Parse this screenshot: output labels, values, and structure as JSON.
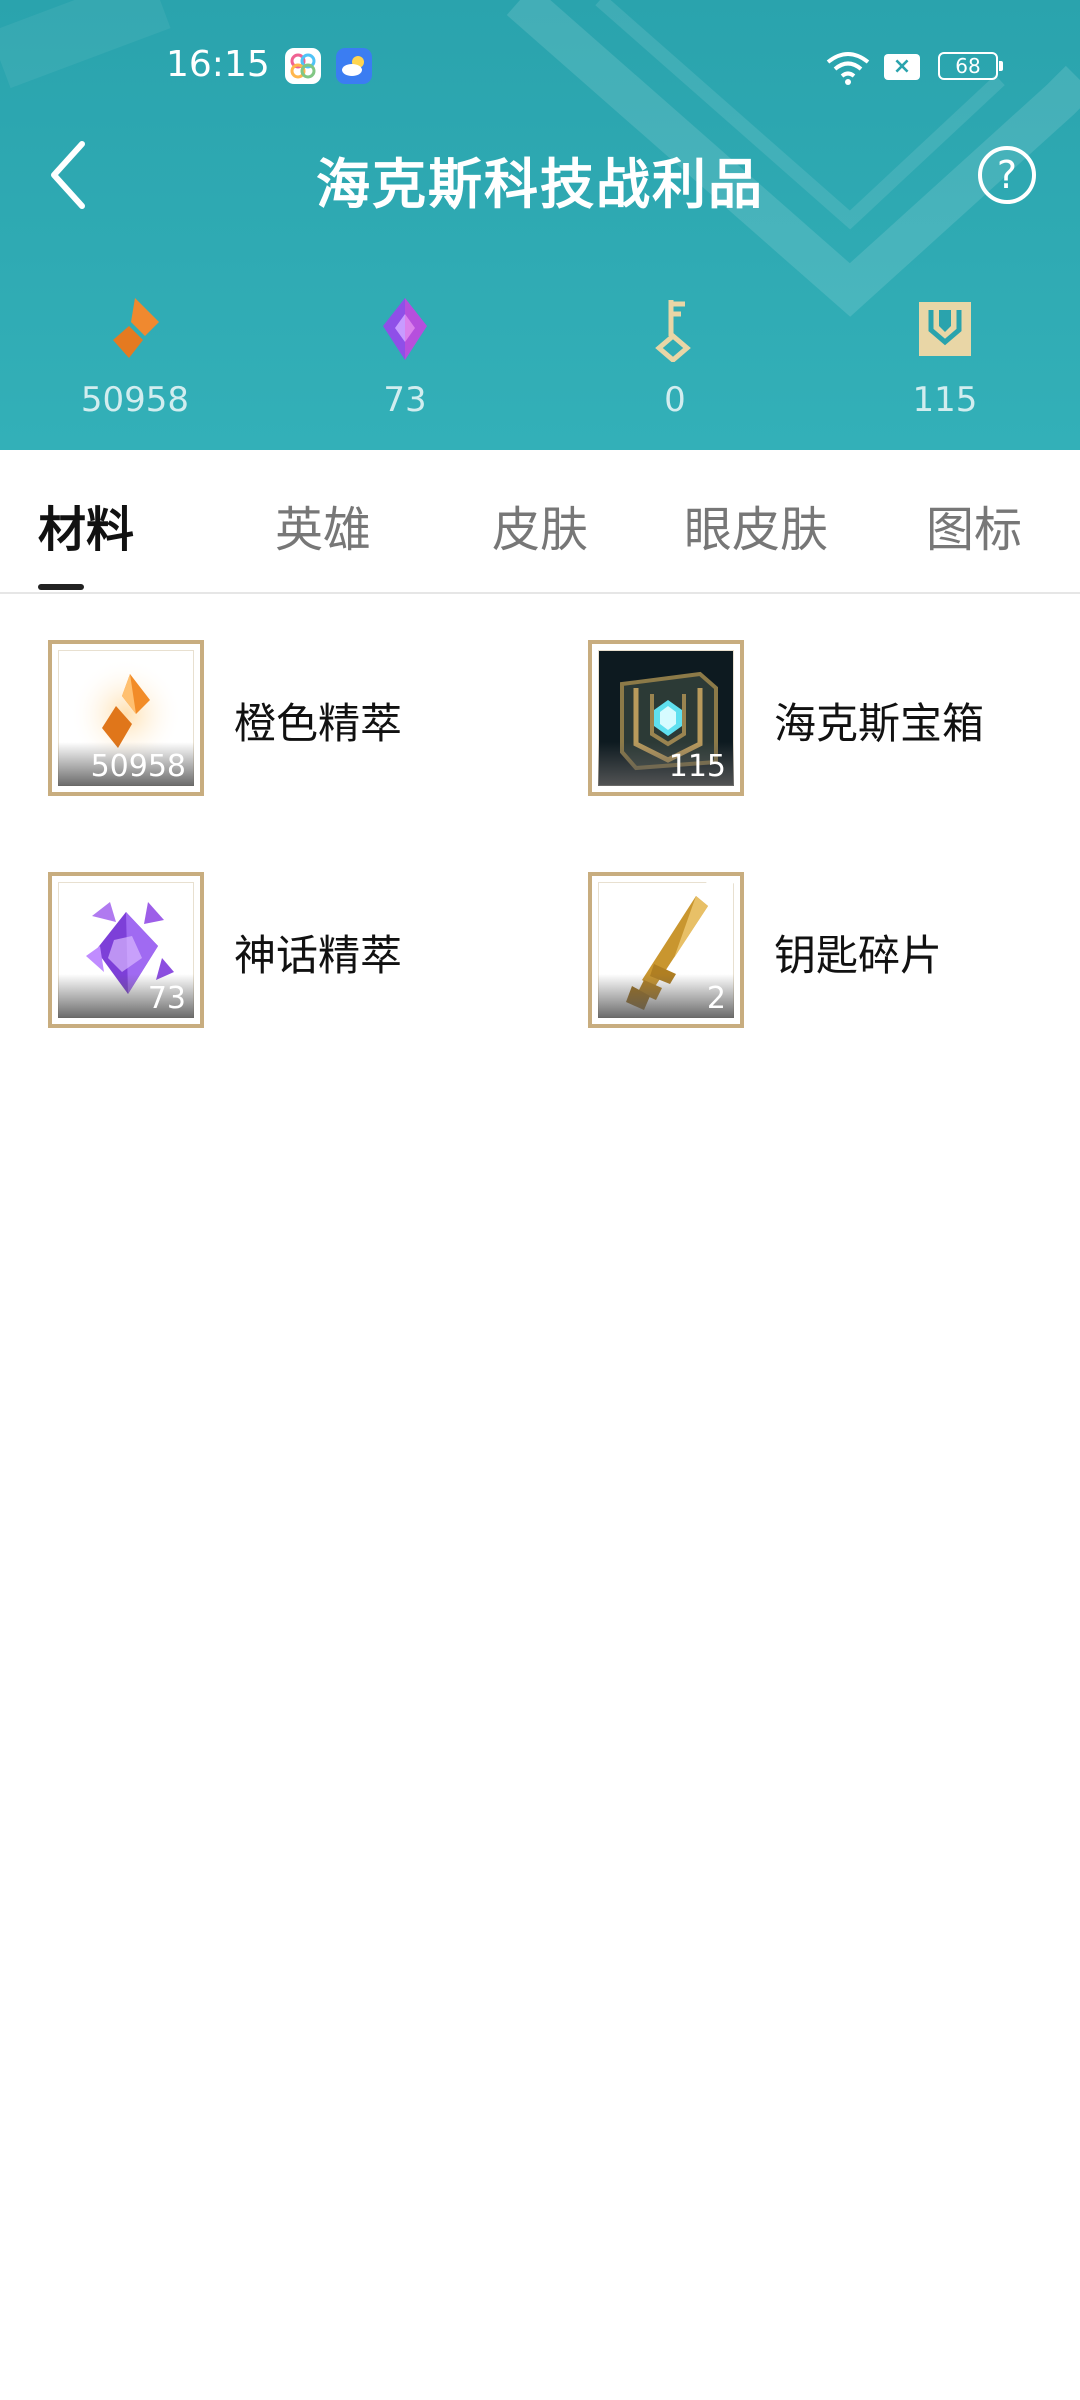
{
  "status_bar": {
    "time": "16:15",
    "battery": "68",
    "notification": "×"
  },
  "header": {
    "title": "海克斯科技战利品",
    "help": "?"
  },
  "currencies": [
    {
      "icon": "orange-essence-icon",
      "value": "50958",
      "color": "#f0892f"
    },
    {
      "icon": "mythic-essence-icon",
      "value": "73",
      "color": "#9b5cf0"
    },
    {
      "icon": "key-icon",
      "value": "0",
      "color": "#e9d6a6"
    },
    {
      "icon": "hextech-chest-icon",
      "value": "115",
      "color": "#e9d6a6"
    }
  ],
  "tabs": [
    {
      "label": "材料",
      "active": true
    },
    {
      "label": "英雄",
      "active": false
    },
    {
      "label": "皮肤",
      "active": false
    },
    {
      "label": "眼皮肤",
      "active": false
    },
    {
      "label": "图标",
      "active": false
    }
  ],
  "items": [
    {
      "name": "橙色精萃",
      "count": "50958",
      "icon": "orange-essence-icon"
    },
    {
      "name": "海克斯宝箱",
      "count": "115",
      "icon": "hextech-chest-icon"
    },
    {
      "name": "神话精萃",
      "count": "73",
      "icon": "mythic-essence-icon"
    },
    {
      "name": "钥匙碎片",
      "count": "2",
      "icon": "key-fragment-icon"
    }
  ]
}
